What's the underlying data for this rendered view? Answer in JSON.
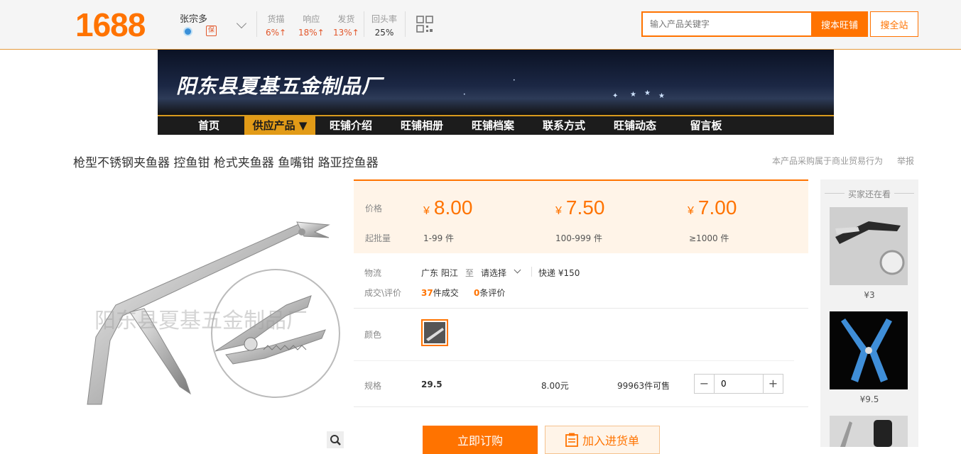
{
  "header": {
    "logo": "1688",
    "shop_owner": "张宗多",
    "badge2": "保",
    "stats": [
      {
        "label": "货描",
        "value": "6%↑"
      },
      {
        "label": "响应",
        "value": "18%↑"
      },
      {
        "label": "发货",
        "value": "13%↑"
      },
      {
        "label": "回头率",
        "value": "25%"
      }
    ],
    "search_placeholder": "输入产品关键字",
    "search_shop_label": "搜本旺铺",
    "search_all_label": "搜全站"
  },
  "banner": {
    "title": "阳东县夏基五金制品厂"
  },
  "nav": {
    "items": [
      "首页",
      "供应产品 ▼",
      "旺铺介绍",
      "旺铺相册",
      "旺铺档案",
      "联系方式",
      "旺铺动态",
      "留言板"
    ],
    "active_index": 1
  },
  "product": {
    "title": "枪型不锈钢夹鱼器 控鱼钳 枪式夹鱼器 鱼嘴钳 路亚控鱼器",
    "notice": "本产品采购属于商业贸易行为",
    "report": "举报",
    "watermark": "阳东县夏基五金制品厂"
  },
  "pricing": {
    "price_label": "价格",
    "moq_label": "起批量",
    "currency": "¥",
    "tiers": [
      {
        "price": "8.00",
        "range": "1-99 件"
      },
      {
        "price": "7.50",
        "range": "100-999 件"
      },
      {
        "price": "7.00",
        "range": "≥1000 件"
      }
    ]
  },
  "logistics": {
    "label": "物流",
    "from": "广东 阳江",
    "to_word": "至",
    "select_label": "请选择",
    "shipping": "快递 ¥150"
  },
  "deals": {
    "label": "成交\\评价",
    "count": "37",
    "count_suffix": "件成交",
    "reviews": "0",
    "reviews_suffix": "条评价"
  },
  "color": {
    "label": "颜色"
  },
  "spec": {
    "label": "规格",
    "value": "29.5",
    "price": "8.00元",
    "stock": "99963件可售",
    "quantity": "0"
  },
  "actions": {
    "buy_label": "立即订购",
    "cart_label": "加入进货单"
  },
  "sidebar": {
    "title": "买家还在看",
    "items": [
      {
        "price": "¥3"
      },
      {
        "price": "¥9.5"
      }
    ]
  },
  "colors": {
    "accent": "#ff7300",
    "nav_active": "#e29b17",
    "price_bg": "#fff4e8"
  }
}
